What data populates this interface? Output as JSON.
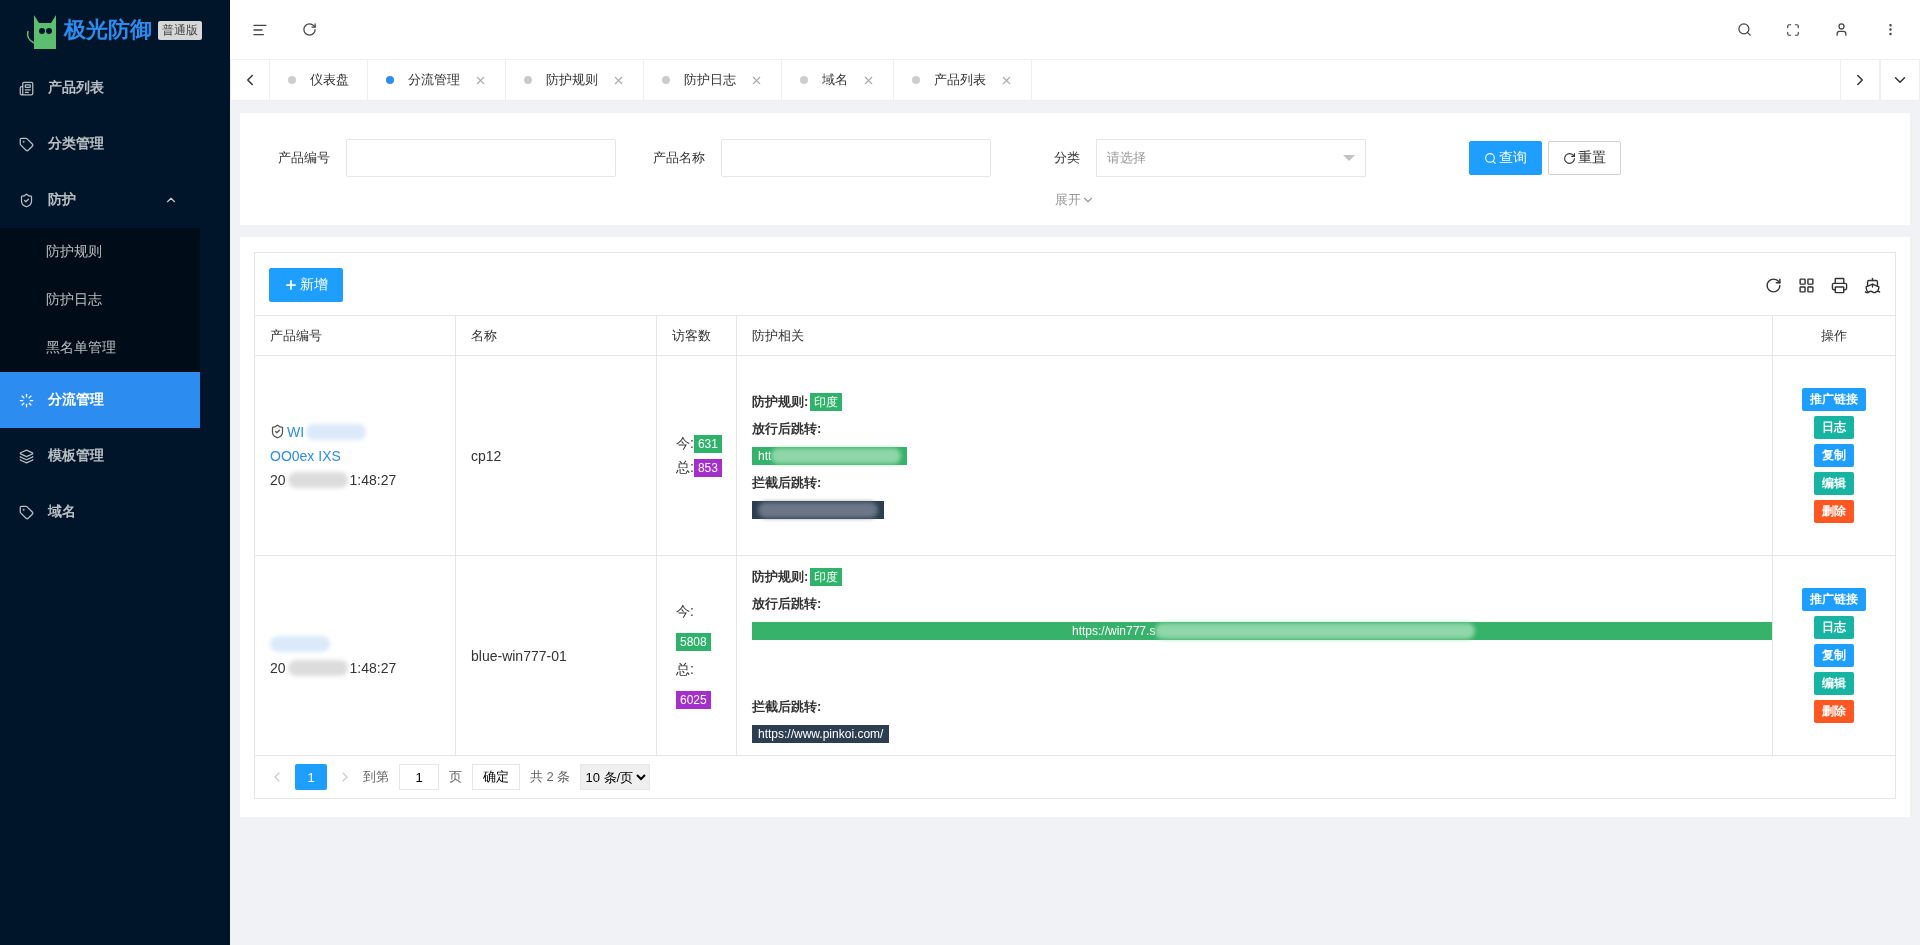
{
  "brand": {
    "name": "极光防御",
    "edition": "普通版"
  },
  "sidebar": {
    "items": [
      {
        "label": "产品列表",
        "kind": "item",
        "selected": false
      },
      {
        "label": "分类管理",
        "kind": "item",
        "selected": false
      },
      {
        "label": "防护",
        "kind": "group",
        "selected": false,
        "expanded": true,
        "children": [
          {
            "label": "防护规则",
            "selected": false
          },
          {
            "label": "防护日志",
            "selected": false
          },
          {
            "label": "黑名单管理",
            "selected": false
          }
        ]
      },
      {
        "label": "分流管理",
        "kind": "item",
        "selected": true
      },
      {
        "label": "模板管理",
        "kind": "item",
        "selected": false
      },
      {
        "label": "域名",
        "kind": "item",
        "selected": false
      }
    ]
  },
  "tabs": [
    {
      "label": "仪表盘",
      "selected": false,
      "closable": false
    },
    {
      "label": "分流管理",
      "selected": true,
      "closable": true
    },
    {
      "label": "防护规则",
      "selected": false,
      "closable": true
    },
    {
      "label": "防护日志",
      "selected": false,
      "closable": true
    },
    {
      "label": "域名",
      "selected": false,
      "closable": true
    },
    {
      "label": "产品列表",
      "selected": false,
      "closable": true
    }
  ],
  "filters": {
    "fields": [
      {
        "kind": "input",
        "label": "产品编号"
      },
      {
        "kind": "input",
        "label": "产品名称"
      },
      {
        "kind": "select",
        "label": "分类",
        "placeholder": "请选择"
      }
    ],
    "search_button": "查询",
    "reset_button": "重置",
    "expand": "展开"
  },
  "table": {
    "add_button": "新增",
    "columns": [
      "产品编号",
      "名称",
      "访客数",
      "防护相关",
      "操作"
    ],
    "rows": [
      {
        "code": {
          "lines": [
            "WI",
            "OO0ex IXS"
          ],
          "blurred": true
        },
        "date_start": "20",
        "date_end": "1:48:27",
        "name": "cp12",
        "stacked": false,
        "visitors": [
          {
            "label": "今:",
            "value": "631",
            "color": "#2fb36a"
          },
          {
            "label": "总:",
            "value": "853",
            "color": "#a52fcc"
          }
        ],
        "rule_label": "防护规则:",
        "rule": "印度",
        "pass_label": "放行后跳转:",
        "pass_url": {
          "text": "htt",
          "blurred": true,
          "wide": false
        },
        "block_label": "拦截后跳转:",
        "block_url": {
          "blurred": true
        },
        "actions": [
          {
            "label": "推广链接",
            "color": "#1e9fff"
          },
          {
            "label": "日志",
            "color": "#17b3a3"
          },
          {
            "label": "复制",
            "color": "#1e9fff"
          },
          {
            "label": "编辑",
            "color": "#17b3a3"
          },
          {
            "label": "删除",
            "color": "#ff5722"
          }
        ]
      },
      {
        "code": {
          "blurred": true
        },
        "date_start": "20",
        "date_end": "1:48:27",
        "name": "blue-win777-01",
        "stacked": true,
        "visitors": [
          {
            "label": "今:",
            "value": "5808",
            "color": "#2fb36a"
          },
          {
            "label": "总:",
            "value": "6025",
            "color": "#a52fcc"
          }
        ],
        "rule_label": "防护规则:",
        "rule": "印度",
        "pass_label": "放行后跳转:",
        "pass_url": {
          "text": "https://win777.s",
          "blurred": true,
          "wide": true
        },
        "block_label": "拦截后跳转:",
        "block_url": {
          "text": "https://www.pinkoi.com/",
          "blurred": false
        },
        "actions": [
          {
            "label": "推广链接",
            "color": "#1e9fff"
          },
          {
            "label": "日志",
            "color": "#17b3a3"
          },
          {
            "label": "复制",
            "color": "#1e9fff"
          },
          {
            "label": "编辑",
            "color": "#17b3a3"
          },
          {
            "label": "删除",
            "color": "#ff5722"
          }
        ]
      }
    ]
  },
  "pagination": {
    "pages": [
      {
        "label": "1",
        "selected": true
      }
    ],
    "goto_label": "到第",
    "goto_value": "1",
    "page_unit": "页",
    "confirm": "确定",
    "total": "共 2 条",
    "page_size": "10 条/页"
  }
}
